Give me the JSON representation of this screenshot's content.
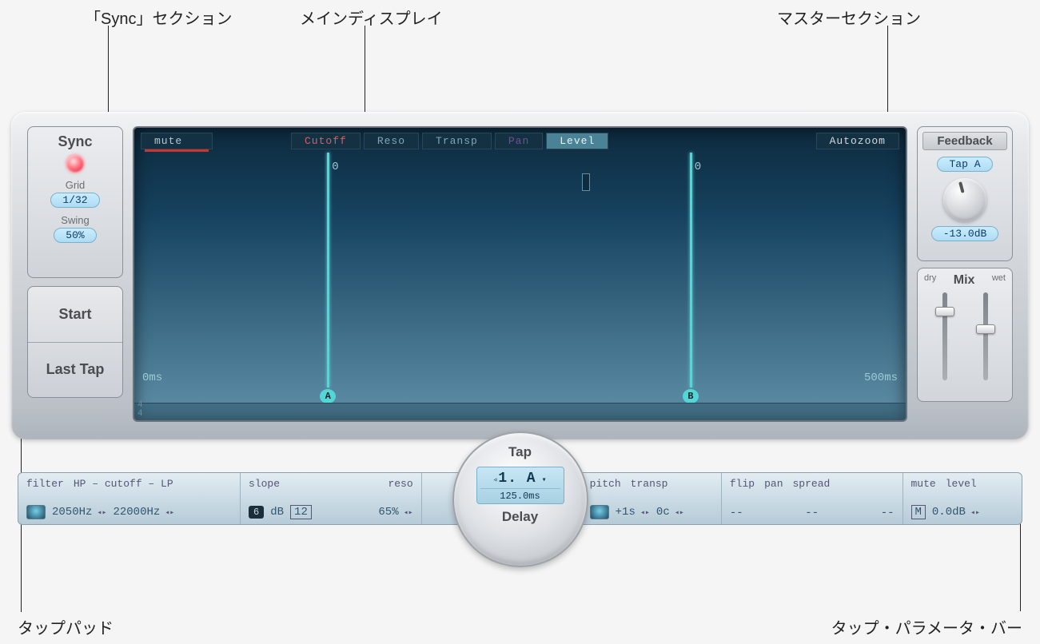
{
  "annotations": {
    "sync": "「Sync」セクション",
    "main": "メインディスプレイ",
    "master": "マスターセクション",
    "tappad": "タップパッド",
    "parambar": "タップ・パラメータ・バー"
  },
  "sync": {
    "title": "Sync",
    "grid_label": "Grid",
    "grid_value": "1/32",
    "swing_label": "Swing",
    "swing_value": "50%"
  },
  "pads": {
    "start": "Start",
    "last": "Last Tap"
  },
  "master": {
    "feedback_title": "Feedback",
    "feedback_tap": "Tap A",
    "feedback_value": "-13.0dB",
    "mix_title": "Mix",
    "mix_dry": "dry",
    "mix_wet": "wet"
  },
  "display": {
    "mute": "mute",
    "cutoff": "Cutoff",
    "reso": "Reso",
    "transp": "Transp",
    "pan": "Pan",
    "level": "Level",
    "autozoom": "Autozoom",
    "tapA_label": "A",
    "tapB_label": "B",
    "zero_a": "0",
    "zero_b": "0",
    "start_ms": "0ms",
    "end_ms": "500ms",
    "time_sig_top": "4",
    "time_sig_bot": "4"
  },
  "tapwheel": {
    "top": "Tap",
    "selected": "1. A",
    "delay_time": "125.0ms",
    "bottom": "Delay"
  },
  "params": {
    "filter_label": "filter",
    "hp_label": "HP – cutoff – LP",
    "hp_val": "2050Hz",
    "lp_val": "22000Hz",
    "slope_label": "slope",
    "slope_db": "6",
    "slope_db_unit": "dB",
    "slope_12": "12",
    "reso_label": "reso",
    "reso_val": "65%",
    "pitch_label": "pitch",
    "pitch_val": "+1s",
    "transp_label": "transp",
    "transp_val": "0c",
    "flip_label": "flip",
    "flip_val": "--",
    "pan_label": "pan",
    "pan_val": "--",
    "spread_label": "spread",
    "spread_val": "--",
    "mute_label": "mute",
    "mute_val": "M",
    "level_label": "level",
    "level_val": "0.0dB"
  }
}
